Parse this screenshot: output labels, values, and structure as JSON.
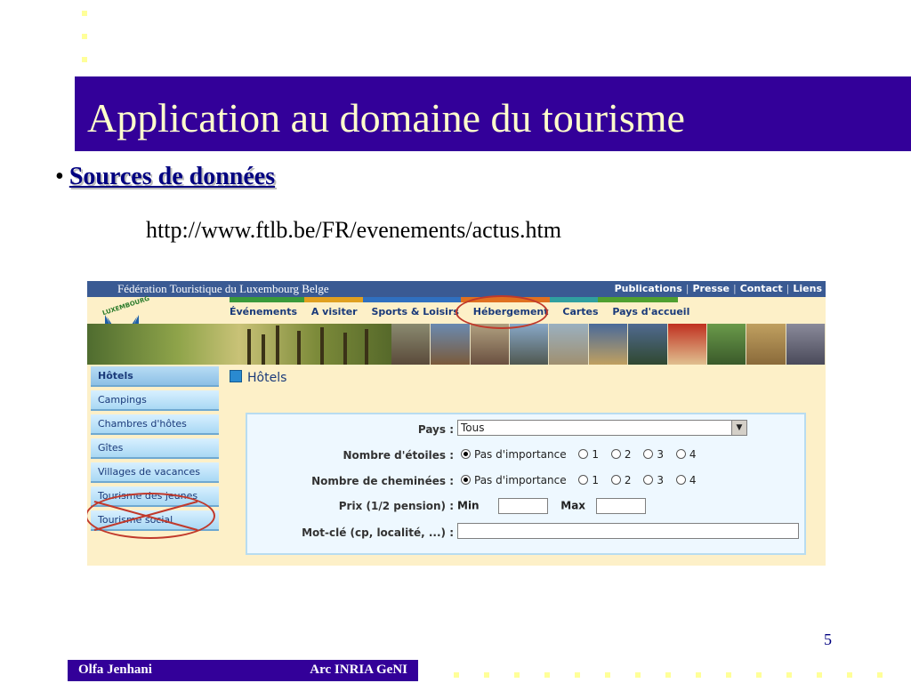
{
  "slide": {
    "title": "Application au domaine du tourisme",
    "bullet_marker": "•",
    "bullet_label": "Sources de données",
    "url": "http://www.ftlb.be/FR/evenements/actus.htm",
    "page_number": "5",
    "footer_author": "Olfa Jenhani",
    "footer_org": "Arc INRIA GeNI",
    "colors": {
      "title_bar": "#330099",
      "title_text": "#ffffcc",
      "accent_dots": "#ffff99",
      "annotation": "#c0392b"
    }
  },
  "site": {
    "federation_name": "Fédération Touristique du Luxembourg Belge",
    "top_links": [
      "Publications",
      "Presse",
      "Contact",
      "Liens"
    ],
    "logo_text": "LUXEMBOURG",
    "nav": [
      "Événements",
      "A visiter",
      "Sports & Loisirs",
      "Hébergement",
      "Cartes",
      "Pays d'accueil"
    ],
    "sidebar": [
      "Hôtels",
      "Campings",
      "Chambres d'hôtes",
      "Gîtes",
      "Villages de vacances",
      "Tourisme des jeunes",
      "Tourisme social"
    ],
    "section_title": "Hôtels",
    "form": {
      "pays_label": "Pays :",
      "pays_value": "Tous",
      "etoiles_label": "Nombre d'étoiles :",
      "cheminees_label": "Nombre de cheminées :",
      "radio_options": [
        "Pas d'importance",
        "1",
        "2",
        "3",
        "4"
      ],
      "prix_label": "Prix (1/2 pension) :",
      "min_label": "Min",
      "max_label": "Max",
      "motcle_label": "Mot-clé (cp, localité, ...) :"
    }
  }
}
